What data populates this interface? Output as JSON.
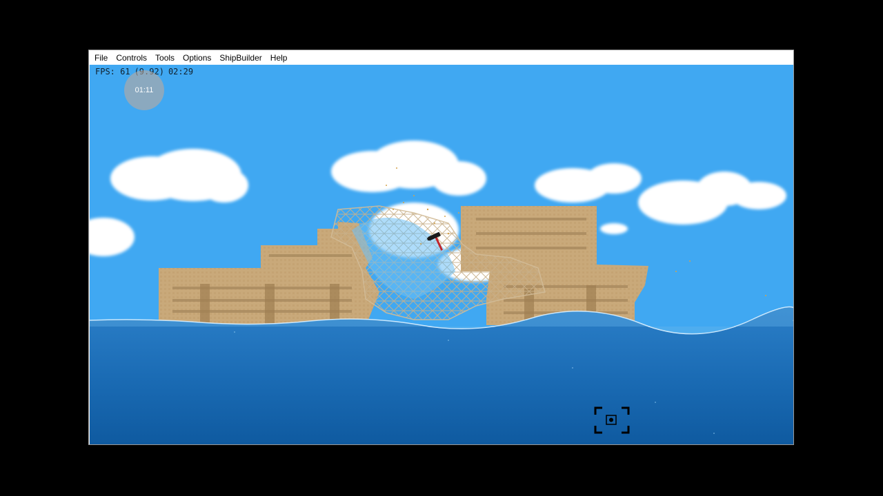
{
  "menu": {
    "file": "File",
    "controls": "Controls",
    "tools": "Tools",
    "options": "Options",
    "shipbuilder": "ShipBuilder",
    "help": "Help"
  },
  "hud": {
    "fps_label": "FPS: 61",
    "fps_secondary": "(9.92)",
    "time": "02:29"
  },
  "timer_bubble": "01:11",
  "colors": {
    "sky": "#40a8f2",
    "water": "#1e6fb8",
    "ship": "#c8a878"
  },
  "icons": {
    "cursor": "hammer-icon",
    "focus": "focus-frame-icon"
  }
}
